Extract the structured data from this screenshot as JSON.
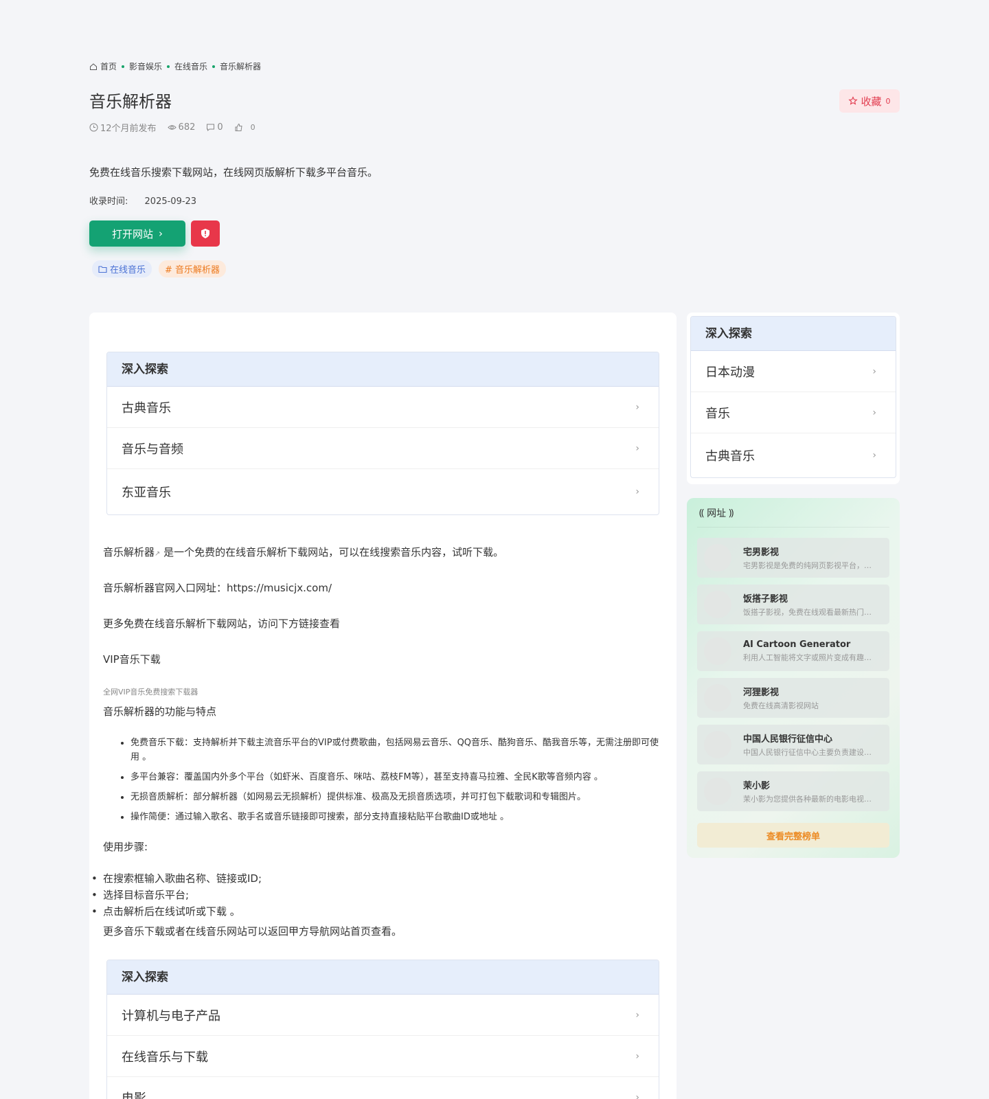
{
  "breadcrumb": {
    "home": "首页",
    "c1": "影音娱乐",
    "c2": "在线音乐",
    "c3": "音乐解析器"
  },
  "title": "音乐解析器",
  "favorite": {
    "label": "收藏",
    "count": "0"
  },
  "meta": {
    "published": "12个月前发布",
    "views": "682",
    "comments": "0",
    "likes": "0"
  },
  "description": "免费在线音乐搜索下载网站，在线网页版解析下载多平台音乐。",
  "collect": {
    "label": "收录时间:",
    "date": "2025-09-23"
  },
  "open_button": "打开网站",
  "tags": {
    "category": "在线音乐",
    "tag": "# 音乐解析器"
  },
  "explore_top": {
    "title": "深入探索",
    "items": [
      "古典音乐",
      "音乐与音频",
      "东亚音乐"
    ]
  },
  "article": {
    "p1_link": "音乐解析器",
    "p1_rest": " 是一个免费的在线音乐解析下载网站，可以在线搜索音乐内容，试听下载。",
    "p2": "音乐解析器官网入口网址：https://musicjx.com/",
    "p3": "更多免费在线音乐解析下载网站，访问下方链接查看",
    "p4": "VIP音乐下载",
    "note": "全网VIP音乐免费搜索下载器",
    "h_features": "音乐解析器的功能与特点",
    "features": [
      "免费音乐下载：支持解析并下载主流音乐平台的VIP或付费歌曲，包括网易云音乐、QQ音乐、酷狗音乐、酷我音乐等，无需注册即可使用 。",
      "多平台兼容：覆盖国内外多个平台（如虾米、百度音乐、咪咕、荔枝FM等），甚至支持喜马拉雅、全民K歌等音频内容 。",
      "无损音质解析：部分解析器（如网易云无损解析）提供标准、极高及无损音质选项，并可打包下载歌词和专辑图片。",
      "操作简便：通过输入歌名、歌手名或音乐链接即可搜索，部分支持直接粘贴平台歌曲ID或地址 。"
    ],
    "h_steps": "使用步骤:",
    "steps": [
      "在搜索框输入歌曲名称、链接或ID;",
      "选择目标音乐平台;",
      "点击解析后在线试听或下载 。"
    ],
    "p_end": "更多音乐下载或者在线音乐网站可以返回甲方导航网站首页查看。"
  },
  "explore_bottom": {
    "title": "深入探索",
    "items": [
      "计算机与电子产品",
      "在线音乐与下载",
      "电影"
    ]
  },
  "side_explore": {
    "title": "深入探索",
    "items": [
      "日本动漫",
      "音乐",
      "古典音乐"
    ]
  },
  "hot": {
    "title": "网址",
    "items": [
      {
        "name": "宅男影视",
        "sub": "宅男影视是免费的纯网页影视平台，…"
      },
      {
        "name": "饭搭子影视",
        "sub": "饭搭子影视，免费在线观看最新热门…"
      },
      {
        "name": "AI Cartoon Generator",
        "sub": "利用人工智能将文字或照片变成有趣…"
      },
      {
        "name": "河狸影视",
        "sub": "免费在线高清影视网站"
      },
      {
        "name": "中国人民银行征信中心",
        "sub": "中国人民银行征信中心主要负责建设…"
      },
      {
        "name": "茉小影",
        "sub": "茉小影为您提供各种最新的电影电视…"
      }
    ],
    "more": "查看完整榜单"
  },
  "colors": {
    "accent": "#14a273",
    "danger": "#e8374a",
    "header_bg": "#e6eefb"
  }
}
